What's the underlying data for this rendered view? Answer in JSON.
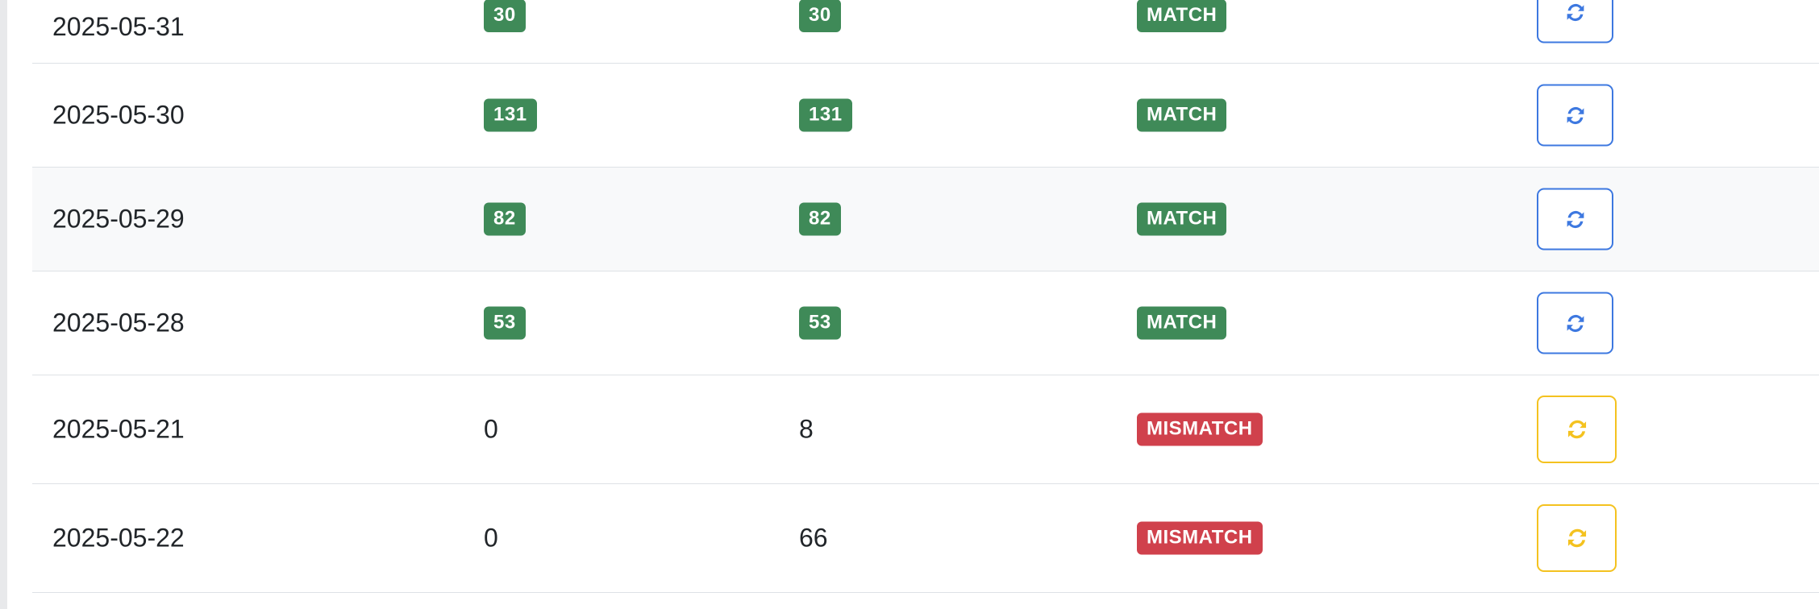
{
  "rows": [
    {
      "date": "2025-05-31",
      "count_a": "30",
      "count_b": "30",
      "status": "MATCH",
      "status_color": "#3f8a58",
      "action_icon": "refresh-icon",
      "action_color": "#3d78e0"
    },
    {
      "date": "2025-05-30",
      "count_a": "131",
      "count_b": "131",
      "status": "MATCH",
      "status_color": "#3f8a58",
      "action_icon": "refresh-icon",
      "action_color": "#3d78e0"
    },
    {
      "date": "2025-05-29",
      "count_a": "82",
      "count_b": "82",
      "status": "MATCH",
      "status_color": "#3f8a58",
      "action_icon": "refresh-icon",
      "action_color": "#3d78e0"
    },
    {
      "date": "2025-05-28",
      "count_a": "53",
      "count_b": "53",
      "status": "MATCH",
      "status_color": "#3f8a58",
      "action_icon": "refresh-icon",
      "action_color": "#3d78e0"
    },
    {
      "date": "2025-05-21",
      "count_a": "0",
      "count_b": "8",
      "status": "MISMATCH",
      "status_color": "#d0414c",
      "action_icon": "refresh-icon",
      "action_color": "#f4c21f"
    },
    {
      "date": "2025-05-22",
      "count_a": "0",
      "count_b": "66",
      "status": "MISMATCH",
      "status_color": "#d0414c",
      "action_icon": "refresh-icon",
      "action_color": "#f4c21f"
    }
  ]
}
